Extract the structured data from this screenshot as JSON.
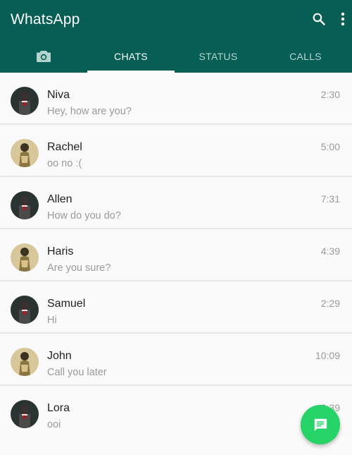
{
  "app": {
    "title": "WhatsApp",
    "colors": {
      "header": "#075e54",
      "fab": "#25d366",
      "background": "#fafafa"
    }
  },
  "header": {
    "icons": [
      "search-icon",
      "more-vert-icon"
    ]
  },
  "tabs": [
    {
      "icon": "camera-icon",
      "label": ""
    },
    {
      "label": "CHATS",
      "active": true
    },
    {
      "label": "STATUS"
    },
    {
      "label": "CALLS"
    }
  ],
  "chats": [
    {
      "name": "Niva",
      "message": "Hey, how are you?",
      "time": "2:30",
      "avatar": "dark"
    },
    {
      "name": "Rachel",
      "message": "oo no :(",
      "time": "5:00",
      "avatar": "gold"
    },
    {
      "name": "Allen",
      "message": "How do you do?",
      "time": "7:31",
      "avatar": "dark"
    },
    {
      "name": "Haris",
      "message": "Are you sure?",
      "time": "4:39",
      "avatar": "gold"
    },
    {
      "name": "Samuel",
      "message": "Hi",
      "time": "2:29",
      "avatar": "dark"
    },
    {
      "name": "John",
      "message": "Call you later",
      "time": "10:09",
      "avatar": "gold"
    },
    {
      "name": "Lora",
      "message": "ooi",
      "time": "2:39",
      "avatar": "dark"
    }
  ],
  "fab": {
    "icon": "new-chat-icon"
  }
}
